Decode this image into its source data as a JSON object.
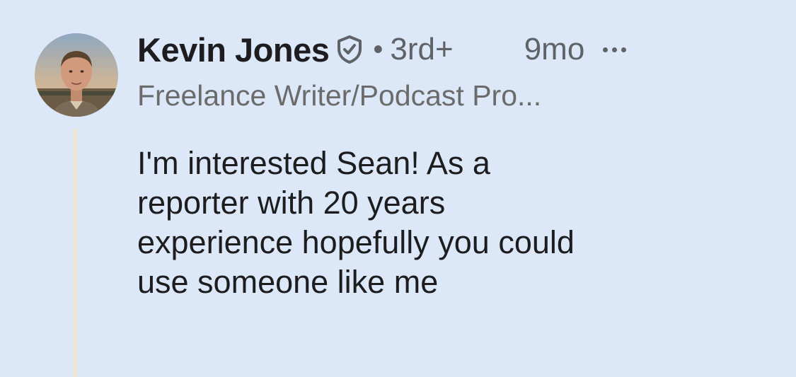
{
  "comment": {
    "author": {
      "name": "Kevin Jones",
      "verified_icon": "shield-check-icon",
      "connection_degree": "3rd+",
      "headline": "Freelance Writer/Podcast Pro..."
    },
    "separator": "•",
    "timestamp": "9mo",
    "more_icon": "ellipsis-icon",
    "body_lines": [
      "I'm interested Sean! As a",
      "reporter with 20 years",
      "experience hopefully you could",
      "use someone like me"
    ]
  },
  "colors": {
    "background": "#dce8f7",
    "text_primary": "#1d1d1f",
    "text_secondary": "#5f6368",
    "thread_line": "#eee6cf"
  }
}
